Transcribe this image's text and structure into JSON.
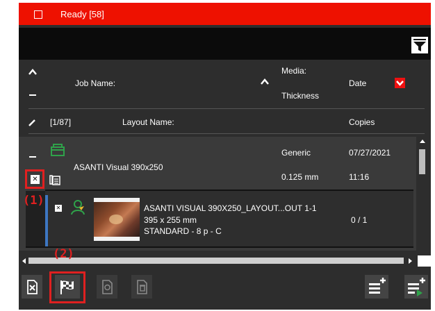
{
  "ready_bar": {
    "label": "Ready [58]"
  },
  "header": {
    "job_name": "Job Name:",
    "media": "Media:",
    "thickness": "Thickness",
    "date": "Date",
    "counter": "[1/87]",
    "layout_name": "Layout Name:",
    "copies": "Copies"
  },
  "job": {
    "name": "ASANTI Visual 390x250",
    "media": "Generic",
    "thickness": "0.125 mm",
    "date": "07/27/2021",
    "time": "11:16"
  },
  "layout": {
    "name": "ASANTI VISUAL 390X250_LAYOUT...OUT 1-1",
    "size": "395 x 255 mm",
    "mode": "STANDARD - 8 p - C",
    "copies": "0 / 1"
  },
  "annotations": {
    "label1": "(1)",
    "label2": "(2)"
  },
  "icons": {
    "filter": "filter-icon",
    "folder": "folder-icon",
    "pages": "pages-icon",
    "person": "person-icon",
    "thumbnail": "thumbnail-image",
    "delete": "delete-document-icon",
    "finish": "checkered-flag-icon",
    "reprint": "reprint-icon",
    "trash": "trash-icon",
    "add_list": "add-list-icon",
    "add_queue": "add-to-queue-icon"
  },
  "colors": {
    "ready_bar": "#ee1100",
    "annotation": "#e02020",
    "accent_green": "#2fa24a",
    "selection_blue": "#3d77c2"
  }
}
